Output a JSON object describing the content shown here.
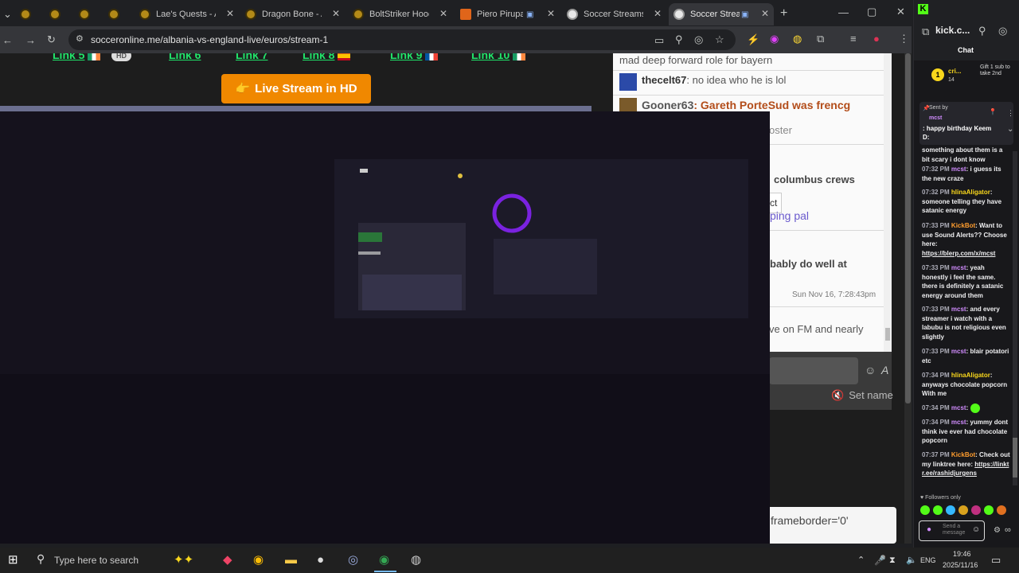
{
  "browser": {
    "tabs": [
      {
        "title": "",
        "active": false
      },
      {
        "title": "",
        "active": false
      },
      {
        "title": "",
        "active": false
      },
      {
        "title": "",
        "active": false
      },
      {
        "title": "Lae's Quests - AQ",
        "active": false
      },
      {
        "title": "Dragon Bone - AQ",
        "active": false
      },
      {
        "title": "BoltStriker Hood -",
        "active": false
      },
      {
        "title": "Piero Pirupa |",
        "active": false
      },
      {
        "title": "Soccer Streams | V",
        "active": false
      },
      {
        "title": "Soccer Stream",
        "active": true
      }
    ],
    "url": "socceronline.me/albania-vs-england-live/euros/stream-1"
  },
  "page": {
    "links": [
      "Link 5",
      "Link 6",
      "Link 7",
      "Link 8",
      "Link 9",
      "Link 10"
    ],
    "hd_badge": "HD",
    "live_button": "Live Stream in HD",
    "chat": [
      {
        "user": "",
        "text": "mad deep forward role for bayern"
      },
      {
        "user": "thecelt67",
        "text": ": no idea who he is lol"
      },
      {
        "user": "Gooner63",
        "text": ": Gareth PorteSud was frencg"
      },
      {
        "user": "",
        "text": "oster"
      },
      {
        "user": "",
        "text": "columbus crews"
      },
      {
        "user": "",
        "text": "ct"
      },
      {
        "user": "",
        "text": "ping pal"
      },
      {
        "user": "",
        "text": "bably do well at"
      },
      {
        "user": "",
        "text": "Sun Nov 16, 7:28:43pm"
      },
      {
        "user": "",
        "text": "ve on FM and nearly"
      }
    ],
    "set_name": "Set name",
    "embed_code": "frameborder='0'"
  },
  "side_panel": {
    "title": "kick.c...",
    "chat_label": "Chat",
    "gift": {
      "name": "cri...",
      "count": "14",
      "text": "Gift 1 sub to take 2nd"
    },
    "pinned": {
      "label": "Sent by",
      "user": "mcst",
      "text": ": happy birthday Keem D:"
    },
    "messages": [
      {
        "time": "",
        "user": "",
        "text": "something about them is a bit scary i dont know"
      },
      {
        "time": "07:32 PM",
        "user": "mcst",
        "text": ": i guess its the new craze"
      },
      {
        "time": "07:32 PM",
        "user": "hlinaAligator",
        "text": ": someone telling they have satanic energy"
      },
      {
        "time": "07:33 PM",
        "user": "KickBot",
        "text": ": Want to use Sound Alerts?? Choose here:",
        "link": "https://blerp.com/x/mcst"
      },
      {
        "time": "07:33 PM",
        "user": "mcst",
        "text": ": yeah honestly i feel the same. there is definitely a satanic energy around them"
      },
      {
        "time": "07:33 PM",
        "user": "mcst",
        "text": ": and every streamer i watch with a labubu is not religious even slightly"
      },
      {
        "time": "07:33 PM",
        "user": "mcst",
        "text": ": blair potatori etc"
      },
      {
        "time": "07:34 PM",
        "user": "hlinaAligator",
        "text": ": anyways chocolate popcorn With me"
      },
      {
        "time": "07:34 PM",
        "user": "mcst",
        "text": ":"
      },
      {
        "time": "07:34 PM",
        "user": "mcst",
        "text": ": yummy dont think ive ever had chocolate popcorn"
      },
      {
        "time": "07:37 PM",
        "user": "KickBot",
        "text": ": Check out my linktree here:",
        "link": "https://linktr.ee/rashidjurgens"
      }
    ],
    "followers_only": "Followers only",
    "send_placeholder": "Send a message"
  },
  "taskbar": {
    "search_placeholder": "Type here to search",
    "lang": "ENG",
    "time": "19:46",
    "date": "2025/11/16"
  },
  "colors": {
    "accent_green": "#53fc18",
    "live_button": "#f08800",
    "link_green": "#21e36a"
  }
}
